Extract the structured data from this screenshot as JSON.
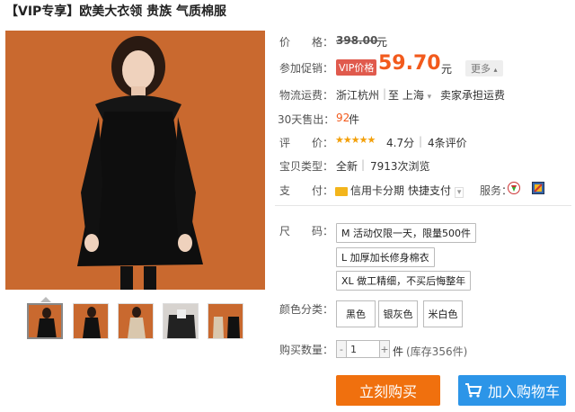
{
  "product": {
    "title": "【VIP专享】欧美大衣领 贵族 气质棉服"
  },
  "details": {
    "price_label": "价　　格：",
    "price_value": "398.00",
    "price_unit": "元",
    "promo_label": "参加促销：",
    "vip_tag": "VIP价格",
    "vip_price": "59.70",
    "vip_unit": "元",
    "more_label": "更多",
    "shipping_label": "物流运费：",
    "shipping_from": "浙江杭州",
    "shipping_to": "至 上海",
    "shipping_fee": "卖家承担运费",
    "sold_label": "30天售出：",
    "sold_count": "92",
    "sold_unit": "件",
    "rating_label": "评　　价：",
    "rating_stars": "★★★★★",
    "rating_score": "4.7分",
    "review_count": "4条评价",
    "type_label": "宝贝类型：",
    "type_value": "全新",
    "views": "7913次浏览",
    "pay_label": "支　　付：",
    "pay_credit": "信用卡分期",
    "pay_quick": "快捷支付",
    "service_label": "服务："
  },
  "options": {
    "size_label": "尺　　码：",
    "sizes": [
      "M 活动仅限一天，限量500件",
      "L 加厚加长修身棉衣",
      "XL 做工精细，不买后悔整年"
    ],
    "color_label": "颜色分类：",
    "colors": [
      "黑色",
      "银灰色",
      "米白色"
    ],
    "qty_label": "购买数量：",
    "qty_minus": "-",
    "qty_value": "1",
    "qty_plus": "+",
    "qty_unit": "件",
    "stock": "(库存356件)"
  },
  "actions": {
    "buy_now": "立刻购买",
    "add_cart": "加入购物车"
  },
  "colors": {
    "accent_orange": "#f25a1c",
    "buy_button": "#f0700e",
    "cart_button": "#2c95e8",
    "image_background": "#c9692f"
  }
}
